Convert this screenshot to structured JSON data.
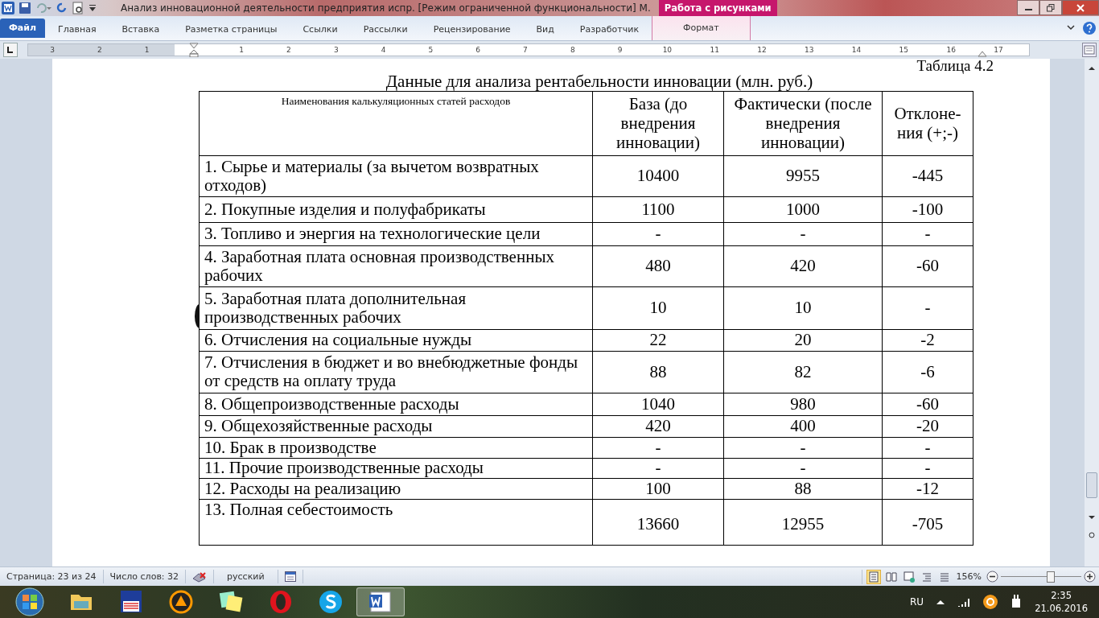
{
  "window": {
    "title": "Анализ инновационной деятельности предприятия испр. [Режим ограниченной функциональности] M.",
    "context_group": "Работа с рисунками"
  },
  "ribbon": {
    "file_tab": "Файл",
    "tabs": [
      {
        "label": "Главная",
        "selected": false
      },
      {
        "label": "Вставка",
        "selected": false
      },
      {
        "label": "Разметка страницы",
        "selected": false
      },
      {
        "label": "Ссылки",
        "selected": false
      },
      {
        "label": "Рассылки",
        "selected": false
      },
      {
        "label": "Рецензирование",
        "selected": false
      },
      {
        "label": "Вид",
        "selected": false
      },
      {
        "label": "Разработчик",
        "selected": false
      },
      {
        "label": "Формат",
        "selected": false,
        "kind": "context"
      }
    ]
  },
  "ruler": {
    "left_labels": [
      "3",
      "2",
      "1"
    ],
    "labels": [
      "1",
      "2",
      "3",
      "4",
      "5",
      "6",
      "7",
      "8",
      "9",
      "10",
      "11",
      "12",
      "13",
      "14",
      "15",
      "16",
      "17"
    ]
  },
  "document": {
    "caption": "Таблица  4.2",
    "title": "Данные для анализа рентабельности инновации (млн. руб.)",
    "table": {
      "columns": [
        "Наименования калькуляционных статей расходов",
        "База (до внедрения инновации)",
        "Фактически (после внедрения инновации)",
        "Отклоне-ния (+;-)"
      ],
      "rows": [
        [
          "1. Сырье и материалы (за вычетом возвратных отходов)",
          "10400",
          "9955",
          "-445"
        ],
        [
          "2. Покупные изделия и полуфабрикаты",
          "1100",
          "1000",
          "-100"
        ],
        [
          "3. Топливо и энергия на технологические цели",
          "-",
          "-",
          "-"
        ],
        [
          "4. Заработная плата основная производственных рабочих",
          "480",
          "420",
          "-60"
        ],
        [
          "5. Заработная плата дополнительная производственных рабочих",
          "10",
          "10",
          "-"
        ],
        [
          "6. Отчисления  на социальные нужды",
          "22",
          "20",
          "-2"
        ],
        [
          "7. Отчисления в бюджет и во внебюджетные фонды от средств на оплату труда",
          "88",
          "82",
          "-6"
        ],
        [
          "8. Общепроизводственные расходы",
          "1040",
          "980",
          "-60"
        ],
        [
          "9. Общехозяйственные расходы",
          "420",
          "400",
          "-20"
        ],
        [
          "10. Брак в производстве",
          "-",
          "-",
          "-"
        ],
        [
          "11. Прочие производственные расходы",
          "-",
          "-",
          "-"
        ],
        [
          "12. Расходы на реализацию",
          "100",
          "88",
          "-12"
        ],
        [
          "13. Полная себестоимость",
          "13660",
          "12955",
          "-705"
        ]
      ]
    }
  },
  "status_bar": {
    "page": "Страница: 23 из 24",
    "words": "Число слов: 32",
    "language": "русский",
    "views": [
      {
        "selected": true
      },
      {
        "selected": false
      },
      {
        "selected": false
      },
      {
        "selected": false
      },
      {
        "selected": false
      }
    ],
    "zoom": "156%",
    "zoom_slider": {
      "level": 0.62
    }
  },
  "taskbar": {
    "apps": [
      {
        "kind": "folder"
      },
      {
        "kind": "floppy"
      },
      {
        "kind": "player"
      },
      {
        "kind": "notes"
      },
      {
        "kind": "opera"
      },
      {
        "kind": "skype"
      },
      {
        "kind": "word",
        "selected": true
      }
    ],
    "language": "RU",
    "time": "2:35",
    "date": "21.06.2016"
  }
}
